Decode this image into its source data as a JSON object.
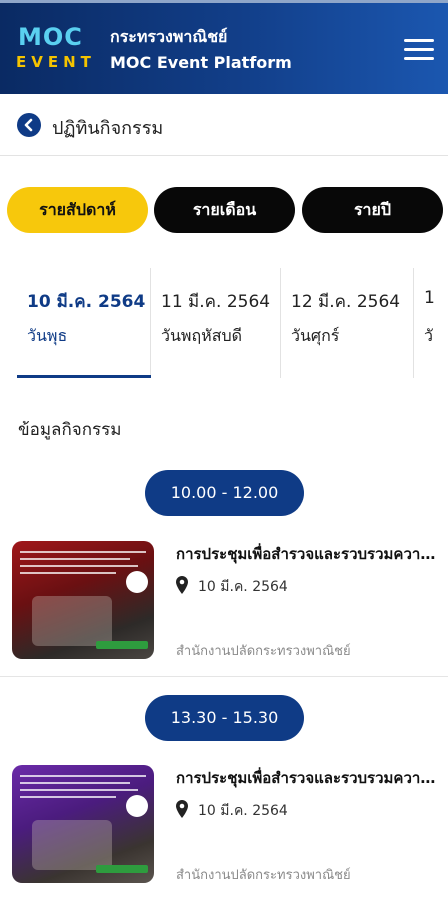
{
  "header": {
    "logo_top": "MOC",
    "logo_bottom": "EVENT",
    "title_th": "กระทรวงพาณิชย์",
    "title_en": "MOC Event Platform",
    "menu_icon": "hamburger-icon"
  },
  "titlebar": {
    "back_icon": "back-arrow-icon",
    "title": "ปฏิทินกิจกรรม"
  },
  "segments": [
    {
      "label": "รายสัปดาห์",
      "selected": true
    },
    {
      "label": "รายเดือน",
      "selected": false
    },
    {
      "label": "รายปี",
      "selected": false
    }
  ],
  "days": [
    {
      "date": "10 มี.ค. 2564",
      "weekday": "วันพุธ",
      "selected": true
    },
    {
      "date": "11 มี.ค. 2564",
      "weekday": "วันพฤหัสบดี",
      "selected": false
    },
    {
      "date": "12 มี.ค. 2564",
      "weekday": "วันศุกร์",
      "selected": false
    },
    {
      "date": "1",
      "weekday": "วั",
      "selected": false
    }
  ],
  "section_title": "ข้อมูลกิจกรรม",
  "events": [
    {
      "time": "10.00 - 12.00",
      "title": "การประชุมเพื่อสำรวจและรวบรวมความคิดเห็น",
      "date": "10 มี.ค. 2564",
      "organizer": "สำนักงานปลัดกระทรวงพาณิชย์",
      "thumb_color": "#a0171a"
    },
    {
      "time": "13.30 - 15.30",
      "title": "การประชุมเพื่อสำรวจและรวบรวมความคิดเห็น",
      "date": "10 มี.ค. 2564",
      "organizer": "สำนักงานปลัดกระทรวงพาณิชย์",
      "thumb_color": "#6a2aa8"
    }
  ],
  "colors": {
    "header_bg": "#0f3b86",
    "accent_yellow": "#f7c80c",
    "pill_black": "#080808",
    "selected_day": "#0f3b86"
  }
}
